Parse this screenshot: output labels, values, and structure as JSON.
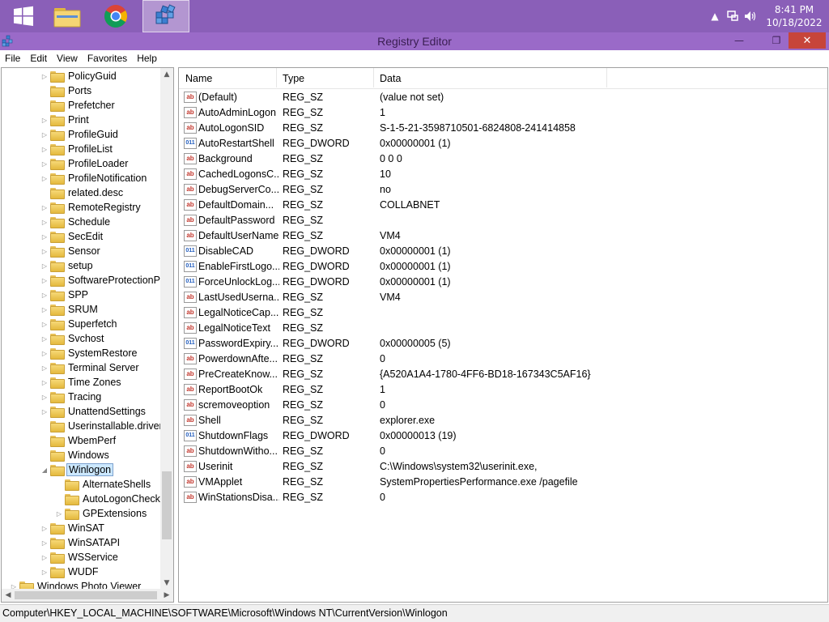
{
  "taskbar": {
    "buttons": [
      {
        "name": "start-button",
        "icon": "windows-logo-icon"
      },
      {
        "name": "file-explorer-button",
        "icon": "folder-icon"
      },
      {
        "name": "chrome-button",
        "icon": "chrome-icon"
      },
      {
        "name": "registry-editor-taskbar-button",
        "icon": "registry-icon"
      }
    ],
    "clock": {
      "time": "8:41 PM",
      "date": "10/18/2022"
    }
  },
  "window": {
    "title": "Registry Editor",
    "controls": {
      "minimize": "—",
      "maximize": "❐",
      "close": "✕"
    }
  },
  "menu": [
    "File",
    "Edit",
    "View",
    "Favorites",
    "Help"
  ],
  "tree": {
    "items": [
      {
        "label": "PolicyGuid",
        "level": 3,
        "expander": "▷"
      },
      {
        "label": "Ports",
        "level": 3,
        "expander": ""
      },
      {
        "label": "Prefetcher",
        "level": 3,
        "expander": ""
      },
      {
        "label": "Print",
        "level": 3,
        "expander": "▷"
      },
      {
        "label": "ProfileGuid",
        "level": 3,
        "expander": "▷"
      },
      {
        "label": "ProfileList",
        "level": 3,
        "expander": "▷"
      },
      {
        "label": "ProfileLoader",
        "level": 3,
        "expander": "▷"
      },
      {
        "label": "ProfileNotification",
        "level": 3,
        "expander": "▷"
      },
      {
        "label": "related.desc",
        "level": 3,
        "expander": ""
      },
      {
        "label": "RemoteRegistry",
        "level": 3,
        "expander": "▷"
      },
      {
        "label": "Schedule",
        "level": 3,
        "expander": "▷"
      },
      {
        "label": "SecEdit",
        "level": 3,
        "expander": "▷"
      },
      {
        "label": "Sensor",
        "level": 3,
        "expander": "▷"
      },
      {
        "label": "setup",
        "level": 3,
        "expander": "▷"
      },
      {
        "label": "SoftwareProtectionPla",
        "level": 3,
        "expander": "▷"
      },
      {
        "label": "SPP",
        "level": 3,
        "expander": "▷"
      },
      {
        "label": "SRUM",
        "level": 3,
        "expander": "▷"
      },
      {
        "label": "Superfetch",
        "level": 3,
        "expander": "▷"
      },
      {
        "label": "Svchost",
        "level": 3,
        "expander": "▷"
      },
      {
        "label": "SystemRestore",
        "level": 3,
        "expander": "▷"
      },
      {
        "label": "Terminal Server",
        "level": 3,
        "expander": "▷"
      },
      {
        "label": "Time Zones",
        "level": 3,
        "expander": "▷"
      },
      {
        "label": "Tracing",
        "level": 3,
        "expander": "▷"
      },
      {
        "label": "UnattendSettings",
        "level": 3,
        "expander": "▷"
      },
      {
        "label": "Userinstallable.drivers",
        "level": 3,
        "expander": ""
      },
      {
        "label": "WbemPerf",
        "level": 3,
        "expander": ""
      },
      {
        "label": "Windows",
        "level": 3,
        "expander": ""
      },
      {
        "label": "Winlogon",
        "level": 3,
        "expander": "◢",
        "selected": true
      },
      {
        "label": "AlternateShells",
        "level": 4,
        "expander": ""
      },
      {
        "label": "AutoLogonChecked",
        "level": 4,
        "expander": ""
      },
      {
        "label": "GPExtensions",
        "level": 4,
        "expander": "▷"
      },
      {
        "label": "WinSAT",
        "level": 3,
        "expander": "▷"
      },
      {
        "label": "WinSATAPI",
        "level": 3,
        "expander": "▷"
      },
      {
        "label": "WSService",
        "level": 3,
        "expander": "▷"
      },
      {
        "label": "WUDF",
        "level": 3,
        "expander": "▷"
      },
      {
        "label": "Windows Photo Viewer",
        "level": 1,
        "expander": "▷"
      }
    ]
  },
  "values_table": {
    "headers": {
      "name": "Name",
      "type": "Type",
      "data": "Data"
    },
    "rows": [
      {
        "name": "(Default)",
        "type": "REG_SZ",
        "data": "(value not set)"
      },
      {
        "name": "AutoAdminLogon",
        "type": "REG_SZ",
        "data": "1"
      },
      {
        "name": "AutoLogonSID",
        "type": "REG_SZ",
        "data": "S-1-5-21-3598710501-6824808-241414858"
      },
      {
        "name": "AutoRestartShell",
        "type": "REG_DWORD",
        "data": "0x00000001 (1)"
      },
      {
        "name": "Background",
        "type": "REG_SZ",
        "data": "0 0 0"
      },
      {
        "name": "CachedLogonsC...",
        "type": "REG_SZ",
        "data": "10"
      },
      {
        "name": "DebugServerCo...",
        "type": "REG_SZ",
        "data": "no"
      },
      {
        "name": "DefaultDomain...",
        "type": "REG_SZ",
        "data": "COLLABNET"
      },
      {
        "name": "DefaultPassword",
        "type": "REG_SZ",
        "data": ""
      },
      {
        "name": "DefaultUserName",
        "type": "REG_SZ",
        "data": "VM4"
      },
      {
        "name": "DisableCAD",
        "type": "REG_DWORD",
        "data": "0x00000001 (1)"
      },
      {
        "name": "EnableFirstLogo...",
        "type": "REG_DWORD",
        "data": "0x00000001 (1)"
      },
      {
        "name": "ForceUnlockLog...",
        "type": "REG_DWORD",
        "data": "0x00000001 (1)"
      },
      {
        "name": "LastUsedUserna...",
        "type": "REG_SZ",
        "data": "VM4"
      },
      {
        "name": "LegalNoticeCap...",
        "type": "REG_SZ",
        "data": ""
      },
      {
        "name": "LegalNoticeText",
        "type": "REG_SZ",
        "data": ""
      },
      {
        "name": "PasswordExpiry...",
        "type": "REG_DWORD",
        "data": "0x00000005 (5)"
      },
      {
        "name": "PowerdownAfte...",
        "type": "REG_SZ",
        "data": "0"
      },
      {
        "name": "PreCreateKnow...",
        "type": "REG_SZ",
        "data": "{A520A1A4-1780-4FF6-BD18-167343C5AF16}"
      },
      {
        "name": "ReportBootOk",
        "type": "REG_SZ",
        "data": "1"
      },
      {
        "name": "scremoveoption",
        "type": "REG_SZ",
        "data": "0"
      },
      {
        "name": "Shell",
        "type": "REG_SZ",
        "data": "explorer.exe"
      },
      {
        "name": "ShutdownFlags",
        "type": "REG_DWORD",
        "data": "0x00000013 (19)"
      },
      {
        "name": "ShutdownWitho...",
        "type": "REG_SZ",
        "data": "0"
      },
      {
        "name": "Userinit",
        "type": "REG_SZ",
        "data": "C:\\Windows\\system32\\userinit.exe,"
      },
      {
        "name": "VMApplet",
        "type": "REG_SZ",
        "data": "SystemPropertiesPerformance.exe /pagefile"
      },
      {
        "name": "WinStationsDisa...",
        "type": "REG_SZ",
        "data": "0"
      }
    ]
  },
  "icon_glyphs": {
    "REG_SZ": "ab",
    "REG_DWORD": "011"
  },
  "status_path": "Computer\\HKEY_LOCAL_MACHINE\\SOFTWARE\\Microsoft\\Windows NT\\CurrentVersion\\Winlogon"
}
